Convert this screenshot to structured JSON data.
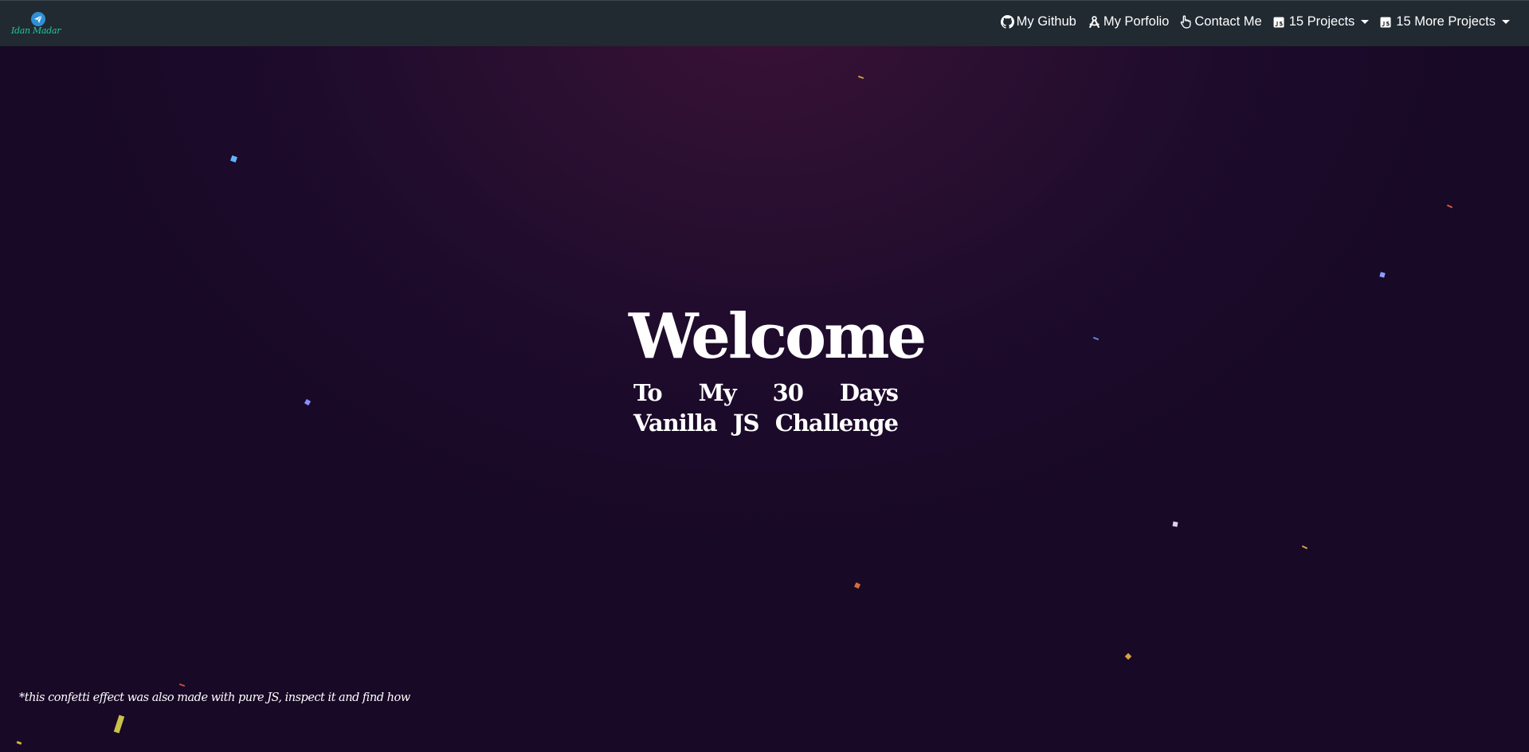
{
  "brand": {
    "name": "Idan Madar",
    "icon": "paper-plane-icon"
  },
  "nav": {
    "github_label": "My Github",
    "portfolio_label": "My Porfolio",
    "contact_label": "Contact Me",
    "projects_label": "15 Projects",
    "more_projects_label": "15 More Projects"
  },
  "hero": {
    "title": "Welcome",
    "subtitle": "To My 30 Days Vanilla JS Challenge"
  },
  "footnote": "*this confetti effect was also made with pure JS, inspect it and find how",
  "colors": {
    "navbar_bg": "#212a31",
    "page_bg": "#1e0b2c",
    "brand_text": "#1fc8a0",
    "text": "#ffffff"
  }
}
